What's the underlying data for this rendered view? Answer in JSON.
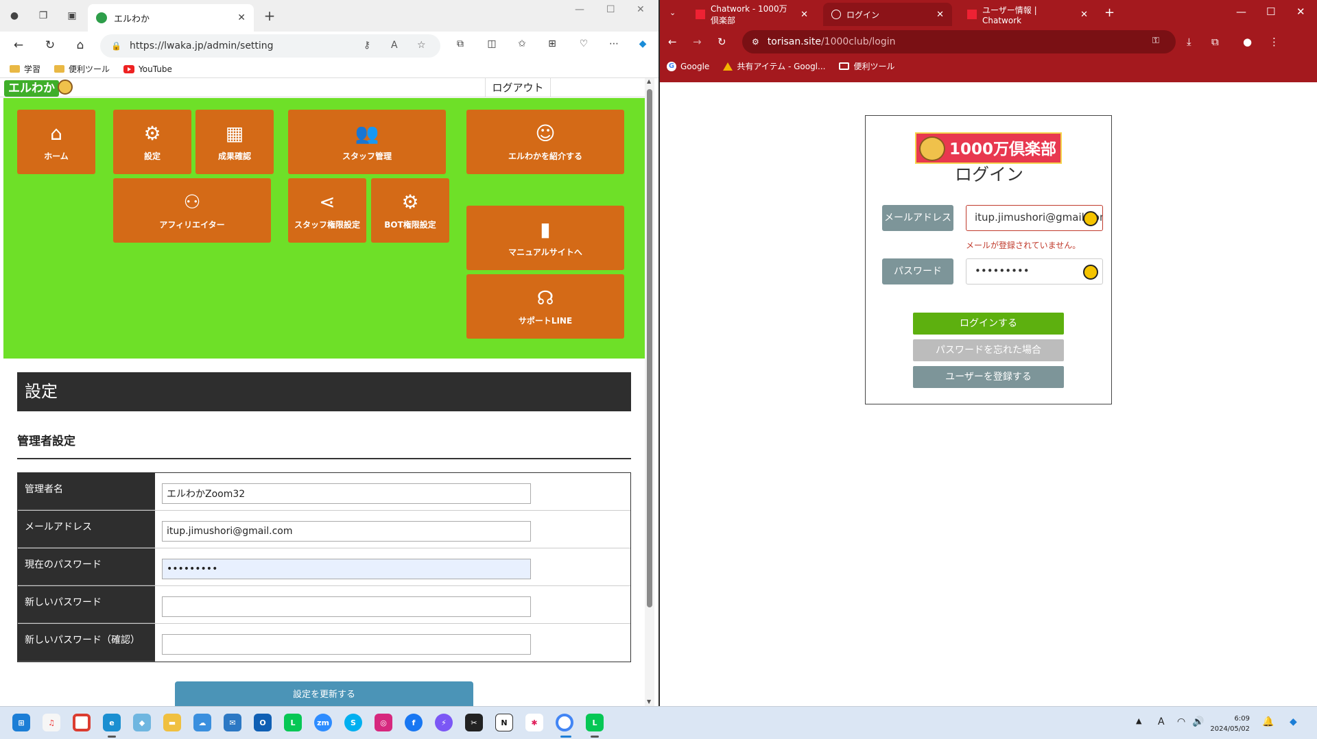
{
  "edge": {
    "tab_title": "エルわか",
    "url": "https://lwaka.jp/admin/setting",
    "bookmarks": [
      "学習",
      "便利ツール",
      "YouTube"
    ]
  },
  "lwaka": {
    "logo": "エルわか",
    "logout": "ログアウト",
    "tiles": {
      "home": "ホーム",
      "settings": "設定",
      "results": "成果確認",
      "staff": "スタッフ管理",
      "introduce": "エルわかを紹介する",
      "affiliator": "アフィリエイター",
      "staff_perm": "スタッフ権限設定",
      "bot_perm": "BOT権限設定",
      "manual": "マニュアルサイトへ",
      "support": "サポートLINE"
    },
    "tile_color": "#d46a17",
    "menu_bg": "#6ee028",
    "section_title": "設定",
    "admin_heading": "管理者設定",
    "form": [
      {
        "label": "管理者名",
        "value": "エルわかZoom32"
      },
      {
        "label": "メールアドレス",
        "value": "itup.jimushori@gmail.com"
      },
      {
        "label": "現在のパスワード",
        "value": "•••••••••"
      },
      {
        "label": "新しいパスワード",
        "value": ""
      },
      {
        "label": "新しいパスワード（確認）",
        "value": ""
      }
    ],
    "submit": "設定を更新する"
  },
  "chrome": {
    "tabs": [
      "Chatwork - 1000万倶楽部",
      "ログイン",
      "ユーザー情報 | Chatwork"
    ],
    "url_host": "torisan.site",
    "url_path": "/1000club/login",
    "bookmarks": [
      "Google",
      "共有アイテム - Googl...",
      "便利ツール"
    ]
  },
  "login": {
    "logo": "1000万倶楽部",
    "title": "ログイン",
    "email_label": "メールアドレス",
    "email_value": "itup.jimushori@gmail.com",
    "error": "メールが登録されていません。",
    "password_label": "パスワード",
    "password_value": "•••••••••",
    "login_btn": "ログインする",
    "forgot_btn": "パスワードを忘れた場合",
    "register_btn": "ユーザーを登録する",
    "colors": {
      "login": "#5db00f",
      "forgot": "#bcbcbc",
      "register": "#7d9599",
      "error": "#c0392b"
    }
  },
  "taskbar": {
    "time": "6:09",
    "date": "2024/05/02",
    "ime": "A"
  }
}
